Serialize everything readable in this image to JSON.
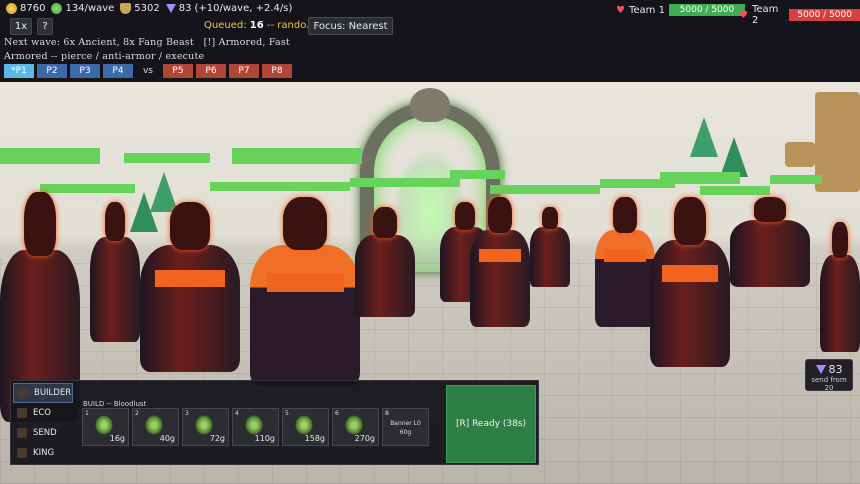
{
  "resources": {
    "gold": "8760",
    "income": "134/wave",
    "lumber": "5302",
    "mythium": "83",
    "mythium_rate": "(+10/wave, +2.4/s)"
  },
  "controls": {
    "speed_label": "1x",
    "help_label": "?",
    "queued_prefix": "Queued:",
    "queued_count": "16",
    "queued_suffix": "-- rando...",
    "focus_label": "Focus: Nearest"
  },
  "teams": [
    {
      "name": "Team 1",
      "hp": "5000 / 5000",
      "color": "#3fae52"
    },
    {
      "name": "Team 2",
      "hp": "5000 / 5000",
      "color": "#d84040"
    }
  ],
  "wave_info": {
    "next_wave": "Next wave: 6x Ancient, 8x Fang Beast",
    "traits": "[!] Armored, Fast",
    "counter": "Armored -- pierce / anti-armor / execute"
  },
  "players": {
    "team1": [
      "*P1",
      "P2",
      "P3",
      "P4"
    ],
    "vs_label": "vs",
    "team2": [
      "P5",
      "P6",
      "P7",
      "P8"
    ]
  },
  "send_badge": {
    "value": "83",
    "label": "send from 20"
  },
  "panel": {
    "tabs": [
      "BUILDER",
      "ECO",
      "SEND",
      "KING"
    ],
    "build_label": "BUILD -- Bloodlust",
    "slots": [
      {
        "num": "1",
        "cost": "16g"
      },
      {
        "num": "2",
        "cost": "40g"
      },
      {
        "num": "3",
        "cost": "72g"
      },
      {
        "num": "4",
        "cost": "110g"
      },
      {
        "num": "5",
        "cost": "158g"
      },
      {
        "num": "6",
        "cost": "270g"
      },
      {
        "num": "8",
        "banner": "Banner L0",
        "cost": "60g"
      }
    ],
    "ready_label": "[R] Ready (38s)"
  },
  "colors": {
    "hp_green": "#67d35a",
    "ready_green": "#2e7f44",
    "team1_bar": "#3fae52",
    "team2_bar": "#d84040",
    "queued_gold": "#f0c640"
  }
}
